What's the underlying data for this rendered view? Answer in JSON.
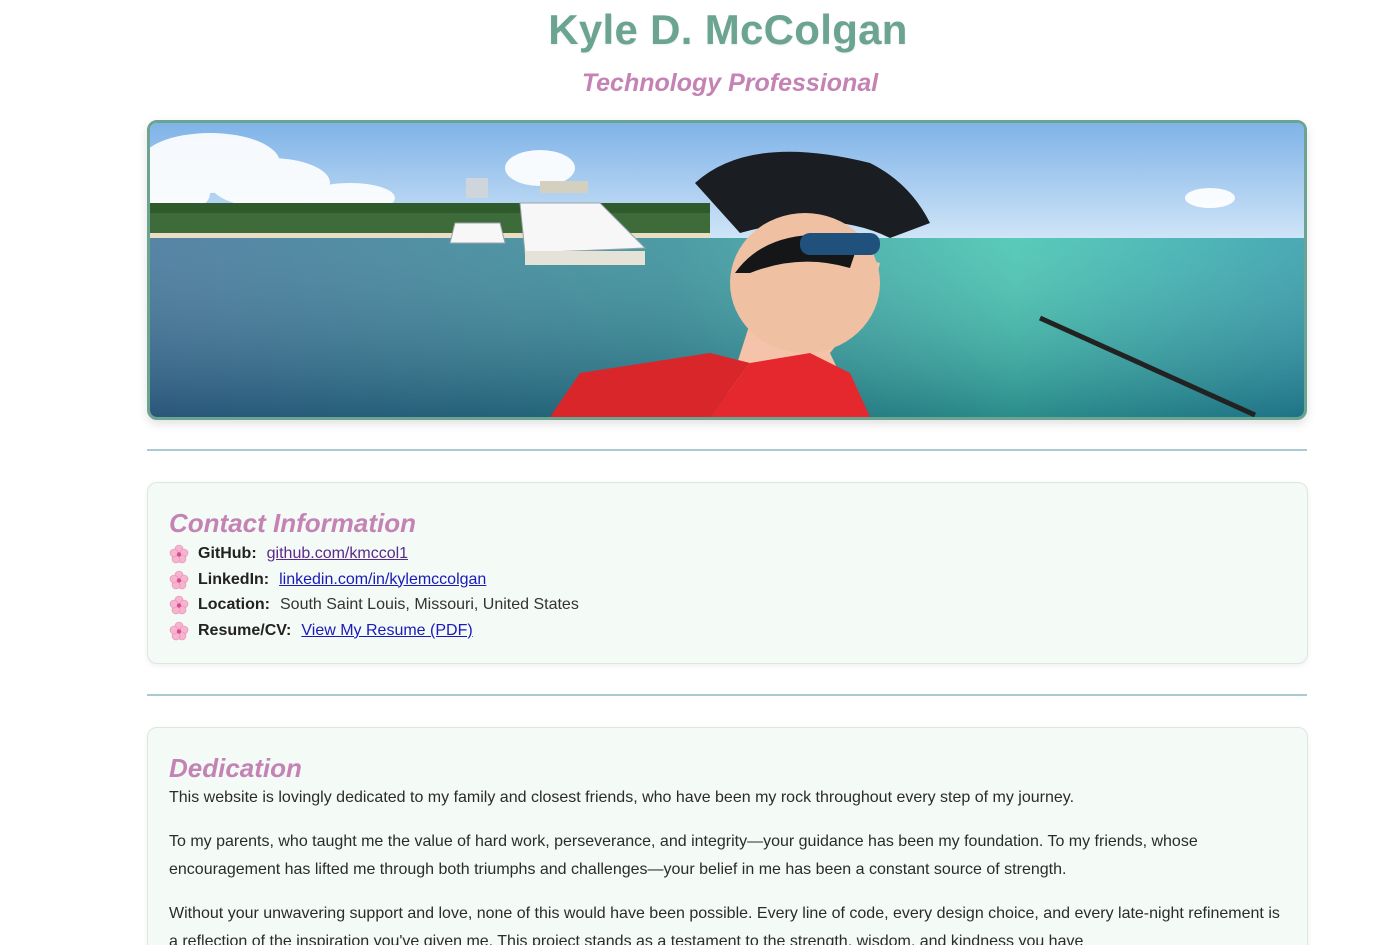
{
  "header": {
    "name": "Kyle D. McColgan",
    "tagline": "Technology Professional"
  },
  "hero": {
    "image_icon": "beach-portrait-photo"
  },
  "contact": {
    "title": "Contact Information",
    "bullet_icon": "cherry-blossom-icon",
    "items": [
      {
        "label": "GitHub:",
        "value": "github.com/kmccol1",
        "is_link": true
      },
      {
        "label": "LinkedIn:",
        "value": "linkedin.com/in/kylemccolgan",
        "is_link": true
      },
      {
        "label": "Location:",
        "value": "South Saint Louis, Missouri, United States",
        "is_link": false
      },
      {
        "label": "Resume/CV:",
        "value": "View My Resume (PDF)",
        "is_link": true
      }
    ]
  },
  "dedication": {
    "title": "Dedication",
    "paragraphs": [
      "This website is lovingly dedicated to my family and closest friends, who have been my rock throughout every step of my journey.",
      "To my parents, who taught me the value of hard work, perseverance, and integrity—your guidance has been my foundation. To my friends, whose encouragement has lifted me through both triumphs and challenges—your belief in me has been a constant source of strength.",
      "Without your unwavering support and love, none of this would have been possible. Every line of code, every design choice, and every late-night refinement is a reflection of the inspiration you've given me. This project stands as a testament to the strength, wisdom, and kindness you have"
    ]
  },
  "colors": {
    "accent_green": "#6ba491",
    "accent_pink": "#c483b4",
    "link_blue": "#1a1ab8",
    "card_bg": "#f4faf6",
    "rule": "#a9c9d3"
  }
}
